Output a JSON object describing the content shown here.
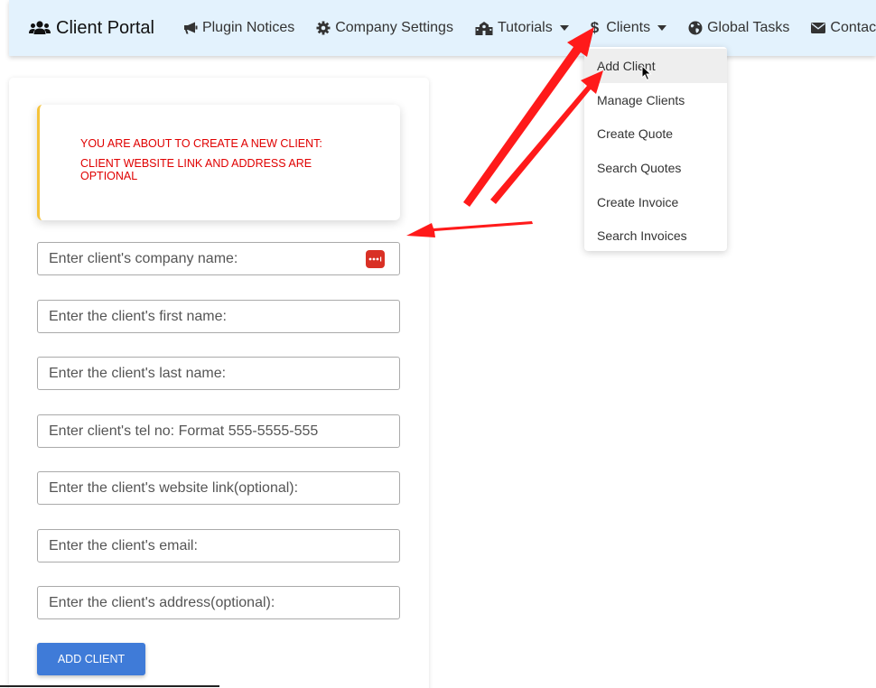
{
  "navbar": {
    "brand": "Client Portal",
    "items": [
      {
        "label": "Plugin Notices",
        "icon": "bullhorn-icon"
      },
      {
        "label": "Company Settings",
        "icon": "gear-icon"
      },
      {
        "label": "Tutorials",
        "icon": "school-icon",
        "dropdown": true
      },
      {
        "label": "Clients",
        "icon": "dollar-icon",
        "dropdown": true
      },
      {
        "label": "Global Tasks",
        "icon": "globe-icon"
      },
      {
        "label": "Contact",
        "icon": "envelope-icon"
      }
    ]
  },
  "clients_menu": {
    "items": [
      "Add Client",
      "Manage Clients",
      "Create Quote",
      "Search Quotes",
      "Create Invoice",
      "Search Invoices"
    ],
    "active": "Add Client"
  },
  "alert": {
    "line1": "YOU ARE ABOUT TO CREATE A NEW CLIENT:",
    "line2": "CLIENT WEBSITE LINK AND ADDRESS ARE OPTIONAL",
    "color": "#e00000",
    "border_color": "#f5c33b"
  },
  "form": {
    "company_placeholder": "Enter client's company name:",
    "first_name_placeholder": "Enter the client's first name:",
    "last_name_placeholder": "Enter the client's last name:",
    "tel_placeholder": "Enter client's tel no: Format 555-5555-555",
    "website_placeholder": "Enter the client's website link(optional):",
    "email_placeholder": "Enter the client's email:",
    "address_placeholder": "Enter the client's address(optional):",
    "submit_label": "ADD CLIENT"
  },
  "colors": {
    "navbar_bg": "#e3f2fd",
    "button_bg": "#3f7bd8",
    "annotation_arrow": "#ff1a1a"
  }
}
